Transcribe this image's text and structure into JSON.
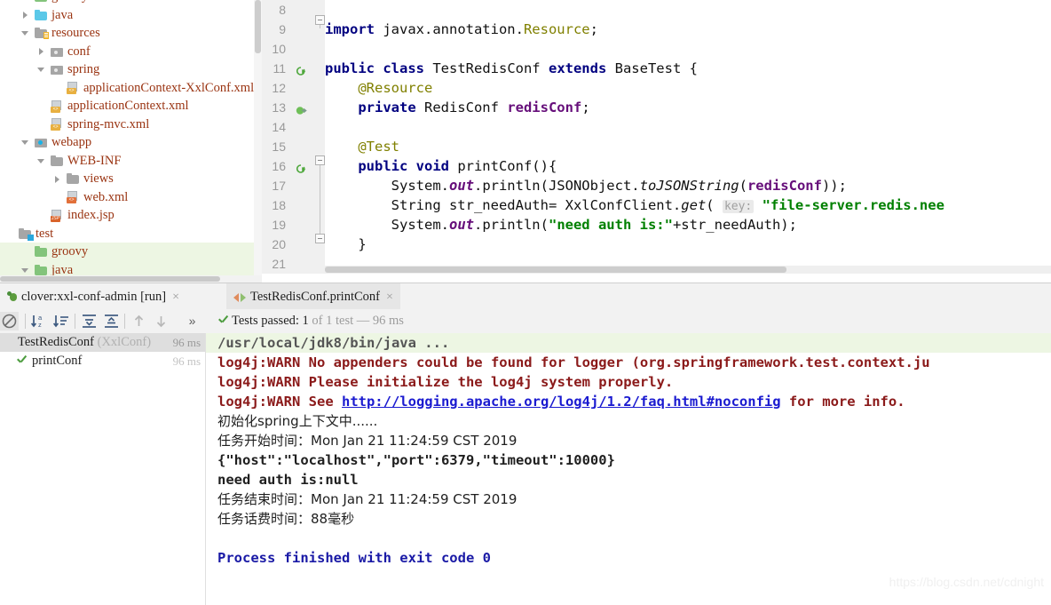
{
  "project_tree": {
    "items": [
      {
        "label": "groovy",
        "indent": 1,
        "arrow": "none",
        "icon": "folder-green",
        "partial": true,
        "selected": false
      },
      {
        "label": "java",
        "indent": 1,
        "arrow": "right",
        "icon": "folder-blue",
        "selected": false
      },
      {
        "label": "resources",
        "indent": 1,
        "arrow": "down",
        "icon": "folder-resources",
        "selected": false
      },
      {
        "label": "conf",
        "indent": 2,
        "arrow": "right",
        "icon": "folder-dot",
        "selected": false
      },
      {
        "label": "spring",
        "indent": 2,
        "arrow": "down",
        "icon": "folder-dot",
        "selected": false
      },
      {
        "label": "applicationContext-XxlConf.xml",
        "indent": 3,
        "arrow": "none",
        "icon": "xml-file",
        "selected": false
      },
      {
        "label": "applicationContext.xml",
        "indent": 2,
        "arrow": "none",
        "icon": "xml-file",
        "selected": false
      },
      {
        "label": "spring-mvc.xml",
        "indent": 2,
        "arrow": "none",
        "icon": "xml-file",
        "selected": false
      },
      {
        "label": "webapp",
        "indent": 1,
        "arrow": "down",
        "icon": "folder-web",
        "selected": false
      },
      {
        "label": "WEB-INF",
        "indent": 2,
        "arrow": "down",
        "icon": "folder-gray",
        "selected": false
      },
      {
        "label": "views",
        "indent": 3,
        "arrow": "right",
        "icon": "folder-gray",
        "selected": false
      },
      {
        "label": "web.xml",
        "indent": 3,
        "arrow": "none",
        "icon": "webxml-file",
        "selected": false
      },
      {
        "label": "index.jsp",
        "indent": 2,
        "arrow": "none",
        "icon": "jsp-file",
        "selected": false
      },
      {
        "label": "test",
        "indent": 0,
        "arrow": "none",
        "icon": "folder-test",
        "selected": false
      },
      {
        "label": "groovy",
        "indent": 1,
        "arrow": "none",
        "icon": "folder-green",
        "selected": true
      },
      {
        "label": "java",
        "indent": 1,
        "arrow": "down",
        "icon": "folder-green",
        "selected": true
      }
    ]
  },
  "editor": {
    "first_line_number": 8,
    "lines": [
      {
        "n": 8,
        "run": false,
        "fold": "none",
        "tokens": []
      },
      {
        "n": 9,
        "run": false,
        "fold": "top",
        "tokens": [
          {
            "t": "import ",
            "c": "kw"
          },
          {
            "t": "javax.annotation.",
            "c": "plain"
          },
          {
            "t": "Resource",
            "c": "anno"
          },
          {
            "t": ";",
            "c": "plain"
          }
        ]
      },
      {
        "n": 10,
        "run": false,
        "fold": "none",
        "tokens": []
      },
      {
        "n": 11,
        "run": "class",
        "fold": "none",
        "tokens": [
          {
            "t": "public class ",
            "c": "kw"
          },
          {
            "t": "TestRedisConf ",
            "c": "cls"
          },
          {
            "t": "extends ",
            "c": "kw"
          },
          {
            "t": "BaseTest {",
            "c": "cls"
          }
        ]
      },
      {
        "n": 12,
        "run": false,
        "fold": "none",
        "tokens": [
          {
            "t": "    @Resource",
            "c": "anno"
          }
        ]
      },
      {
        "n": 13,
        "run": "impl",
        "fold": "none",
        "tokens": [
          {
            "t": "    private ",
            "c": "kw"
          },
          {
            "t": "RedisConf ",
            "c": "cls"
          },
          {
            "t": "redisConf",
            "c": "fld"
          },
          {
            "t": ";",
            "c": "plain"
          }
        ]
      },
      {
        "n": 14,
        "run": false,
        "fold": "none",
        "tokens": []
      },
      {
        "n": 15,
        "run": false,
        "fold": "none",
        "tokens": [
          {
            "t": "    @Test",
            "c": "anno"
          }
        ]
      },
      {
        "n": 16,
        "run": "method",
        "fold": "box",
        "tokens": [
          {
            "t": "    public void ",
            "c": "kw"
          },
          {
            "t": "printConf(){",
            "c": "cls"
          }
        ]
      },
      {
        "n": 17,
        "run": false,
        "fold": "none",
        "tokens": [
          {
            "t": "        System.",
            "c": "plain"
          },
          {
            "t": "out",
            "c": "stat"
          },
          {
            "t": ".println(JSONObject.",
            "c": "plain"
          },
          {
            "t": "toJSONString",
            "c": "mth"
          },
          {
            "t": "(",
            "c": "plain"
          },
          {
            "t": "redisConf",
            "c": "fld"
          },
          {
            "t": "));",
            "c": "plain"
          }
        ]
      },
      {
        "n": 18,
        "run": false,
        "fold": "none",
        "tokens": [
          {
            "t": "        String str_needAuth= XxlConfClient.",
            "c": "plain"
          },
          {
            "t": "get",
            "c": "mth"
          },
          {
            "t": "( ",
            "c": "plain"
          },
          {
            "t": "key:",
            "c": "hintkey"
          },
          {
            "t": " ",
            "c": "plain"
          },
          {
            "t": "\"file-server.redis.nee",
            "c": "str"
          }
        ]
      },
      {
        "n": 19,
        "run": false,
        "fold": "none",
        "tokens": [
          {
            "t": "        System.",
            "c": "plain"
          },
          {
            "t": "out",
            "c": "stat"
          },
          {
            "t": ".println(",
            "c": "plain"
          },
          {
            "t": "\"need auth is:\"",
            "c": "str"
          },
          {
            "t": "+str_needAuth);",
            "c": "plain"
          }
        ]
      },
      {
        "n": 20,
        "run": false,
        "fold": "box",
        "tokens": [
          {
            "t": "    }",
            "c": "plain"
          }
        ]
      },
      {
        "n": 21,
        "run": false,
        "fold": "none",
        "tokens": []
      }
    ]
  },
  "tabs": {
    "items": [
      {
        "label": "clover:xxl-conf-admin [run]",
        "icon": "bug-icon",
        "active": false,
        "close": "×"
      },
      {
        "label": "TestRedisConf.printConf",
        "icon": "run-arrows-icon",
        "active": true,
        "close": "×"
      }
    ]
  },
  "run_toolbar": {
    "buttons": [
      {
        "name": "suppress-icon",
        "label": ""
      },
      {
        "name": "sort-alphabetically-icon",
        "label": ""
      },
      {
        "name": "sort-by-duration-icon",
        "label": ""
      },
      {
        "name": "expand-all-icon",
        "label": ""
      },
      {
        "name": "collapse-all-icon",
        "label": ""
      },
      {
        "name": "prev-failed-icon",
        "label": ""
      },
      {
        "name": "next-failed-icon",
        "label": ""
      },
      {
        "name": "more-options-icon",
        "label": "»"
      }
    ],
    "status_prefix": "Tests passed:",
    "status_count": "1",
    "status_suffix": "of 1 test",
    "status_dash": "—",
    "status_time": "96 ms"
  },
  "test_tree": {
    "rows": [
      {
        "label": "TestRedisConf",
        "paren": "(XxlConf)",
        "time": "96 ms",
        "selected": true,
        "check": false,
        "indent": 0
      },
      {
        "label": "printConf",
        "paren": "",
        "time": "96 ms",
        "selected": false,
        "check": true,
        "indent": 1
      }
    ]
  },
  "console": {
    "lines": [
      {
        "kind": "cmd",
        "text": "/usr/local/jdk8/bin/java ..."
      },
      {
        "kind": "warn",
        "text": "log4j:WARN No appenders could be found for logger (org.springframework.test.context.ju"
      },
      {
        "kind": "warn",
        "text": "log4j:WARN Please initialize the log4j system properly."
      },
      {
        "kind": "warn-link",
        "pre": "log4j:WARN See ",
        "link": "http://logging.apache.org/log4j/1.2/faq.html#noconfig",
        "post": " for more info."
      },
      {
        "kind": "cn",
        "text": "初始化spring上下文中......"
      },
      {
        "kind": "cn",
        "text": "任务开始时间：Mon Jan 21 11:24:59 CST 2019"
      },
      {
        "kind": "mono",
        "text": "{\"host\":\"localhost\",\"port\":6379,\"timeout\":10000}"
      },
      {
        "kind": "mono",
        "text": "need auth is:null"
      },
      {
        "kind": "cn",
        "text": "任务结束时间：Mon Jan 21 11:24:59 CST 2019"
      },
      {
        "kind": "cn",
        "text": "任务话费时间：88毫秒"
      },
      {
        "kind": "blank",
        "text": ""
      },
      {
        "kind": "fin",
        "text": "Process finished with exit code 0"
      }
    ]
  },
  "watermark": {
    "text": "https://blog.csdn.net/cdnight"
  },
  "colors": {
    "keyword": "#000080",
    "string": "#008000",
    "annotation": "#808000",
    "field": "#660e7a",
    "warn": "#8b1a1a",
    "link": "#1a1ad0",
    "finished": "#1a1aa6",
    "selection_green": "#edf6e3",
    "tab_active": "#e6e6e6"
  }
}
